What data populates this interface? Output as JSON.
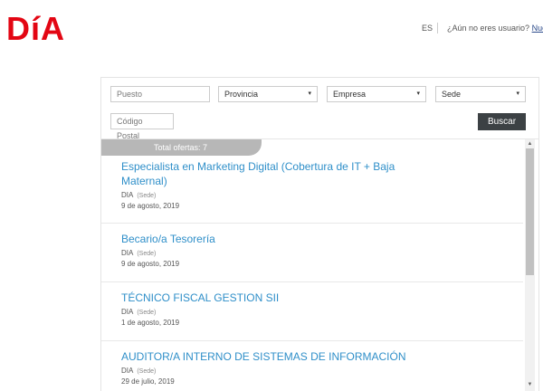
{
  "header": {
    "logo": "DíA",
    "language": "ES",
    "account_prompt": "¿Aún no eres usuario?",
    "register_link": "Nue"
  },
  "search": {
    "puesto_placeholder": "Puesto",
    "provincia_label": "Provincia",
    "empresa_label": "Empresa",
    "sede_label": "Sede",
    "codigo_postal_placeholder": "Código Postal",
    "buscar_label": "Buscar"
  },
  "results": {
    "total_label": "Total ofertas: 7",
    "offers": [
      {
        "title": "Especialista en Marketing Digital (Cobertura de IT + Baja Maternal)",
        "company": "DIA",
        "location": "(Sede)",
        "date": "9 de agosto, 2019"
      },
      {
        "title": "Becario/a Tesorería",
        "company": "DIA",
        "location": "(Sede)",
        "date": "9 de agosto, 2019"
      },
      {
        "title": "TÉCNICO FISCAL GESTION SII",
        "company": "DIA",
        "location": "(Sede)",
        "date": "1 de agosto, 2019"
      },
      {
        "title": "AUDITOR/A INTERNO DE SISTEMAS DE INFORMACIÓN",
        "company": "DIA",
        "location": "(Sede)",
        "date": "29 de julio, 2019"
      }
    ]
  },
  "icons": {
    "dropdown": "▾",
    "scroll_up": "▲",
    "scroll_down": "▼"
  },
  "colors": {
    "brand": "#e30613",
    "link": "#2f8fc9",
    "button": "#3c4144"
  }
}
